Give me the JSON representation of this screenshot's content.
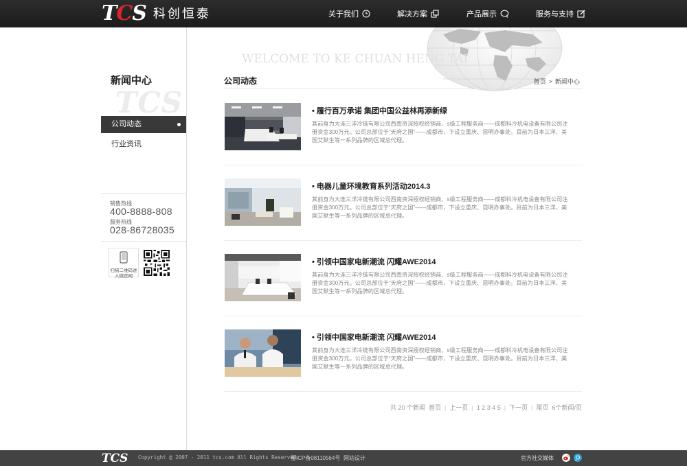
{
  "header": {
    "logo_mark": "TCS",
    "logo_cn": "科创恒泰",
    "nav": [
      {
        "label": "关于我们",
        "icon": "clock-icon"
      },
      {
        "label": "解决方案",
        "icon": "external-link-icon"
      },
      {
        "label": "产品展示",
        "icon": "chat-bubble-icon"
      },
      {
        "label": "服务与支持",
        "icon": "edit-icon"
      }
    ]
  },
  "banner": {
    "text": "WELCOME TO KE CHUAN HENG TAI"
  },
  "sidebar": {
    "title": "新闻中心",
    "watermark": "TCS",
    "items": [
      {
        "label": "公司动态",
        "active": true
      },
      {
        "label": "行业资讯",
        "active": false
      }
    ],
    "hotline_sales_label": "销售热线",
    "hotline_sales": "400-8888-808",
    "hotline_service_label": "服务热线",
    "hotline_service": "028-86728035",
    "qr_hint": "扫描二维码进入微官网"
  },
  "main": {
    "title": "公司动态",
    "breadcrumb": [
      "首页",
      ">",
      "新闻中心"
    ],
    "news": [
      {
        "title": "• 履行百万承诺 集团中国公益林再添新绿",
        "desc": "其前身为大连三洋冷链有限公司西南资深授权经销商、s级工程服务商——成都科冷机电设备有限公司注册资金300万元。公司总部位于“天府之国”——成都市，下设立重庆、昆明办事处。目前为日本三洋、美国艾默生等一系列品牌的区域总代理。",
        "thumb": "office-interior"
      },
      {
        "title": "• 电器儿童环境教育系列活动2014.3",
        "desc": "其前身为大连三洋冷链有限公司西南资深授权经销商、s级工程服务商——成都科冷机电设备有限公司注册资金300万元。公司总部位于“天府之国”——成都市，下设立重庆、昆明办事处。目前为日本三洋、美国艾默生等一系列品牌的区域总代理。",
        "thumb": "glass-office"
      },
      {
        "title": "• 引领中国家电新潮流 闪耀AWE2014",
        "desc": "其前身为大连三洋冷链有限公司西南资深授权经销商、s级工程服务商——成都科冷机电设备有限公司注册资金300万元。公司总部位于“天府之国”——成都市，下设立重庆、昆明办事处。目前为日本三洋、美国艾默生等一系列品牌的区域总代理。",
        "thumb": "white-office"
      },
      {
        "title": "• 引领中国家电新潮流 闪耀AWE2014",
        "desc": "其前身为大连三洋冷链有限公司西南资深授权经销商、s级工程服务商——成都科冷机电设备有限公司注册资金300万元。公司总部位于“天府之国”——成都市，下设立重庆、昆明办事处。目前为日本三洋、美国艾默生等一系列品牌的区域总代理。",
        "thumb": "business-meeting"
      }
    ]
  },
  "pager": {
    "total": "共 20 个新闻",
    "first": "首页",
    "prev": "上一页",
    "pages": "1 2 3 4 5",
    "next": "下一页",
    "last": "尾页",
    "per_page": "6个新闻/页"
  },
  "footer": {
    "logo": "TCS",
    "copyright": "Copyright @ 2007 - 2011 tcs.com All Rights Reserved.",
    "icp": "蜀ICP备08110564号",
    "design": "网站设计",
    "social_label": "官方社交媒体",
    "colors": {
      "weibo": "#e0202b",
      "qq": "#2aa0d8"
    }
  }
}
